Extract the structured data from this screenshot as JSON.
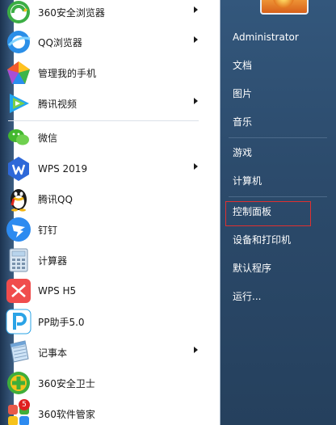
{
  "programs": [
    {
      "label": "360安全浏览器",
      "icon": "360-browser-icon",
      "has_submenu": true
    },
    {
      "label": "QQ浏览器",
      "icon": "qq-browser-icon",
      "has_submenu": true
    },
    {
      "label": "管理我的手机",
      "icon": "phone-manager-icon",
      "has_submenu": false
    },
    {
      "label": "腾讯视频",
      "icon": "tencent-video-icon",
      "has_submenu": true
    },
    {
      "label": "微信",
      "icon": "wechat-icon",
      "has_submenu": false
    },
    {
      "label": "WPS 2019",
      "icon": "wps-icon",
      "has_submenu": true
    },
    {
      "label": "腾讯QQ",
      "icon": "qq-penguin-icon",
      "has_submenu": false
    },
    {
      "label": "钉钉",
      "icon": "dingtalk-icon",
      "has_submenu": false
    },
    {
      "label": "计算器",
      "icon": "calculator-icon",
      "has_submenu": false
    },
    {
      "label": "WPS H5",
      "icon": "wps-h5-icon",
      "has_submenu": false
    },
    {
      "label": "PP助手5.0",
      "icon": "pp-assistant-icon",
      "has_submenu": false
    },
    {
      "label": "记事本",
      "icon": "notepad-icon",
      "has_submenu": true
    },
    {
      "label": "360安全卫士",
      "icon": "360-safe-icon",
      "has_submenu": false
    },
    {
      "label": "360软件管家",
      "icon": "360-software-manager-icon",
      "has_submenu": false,
      "badge": "5"
    }
  ],
  "user_panel": {
    "username": "Administrator",
    "items": [
      {
        "label": "文档"
      },
      {
        "label": "图片"
      },
      {
        "label": "音乐"
      },
      {
        "label": "游戏"
      },
      {
        "label": "计算机"
      },
      {
        "label": "控制面板",
        "highlighted": true
      },
      {
        "label": "设备和打印机"
      },
      {
        "label": "默认程序"
      },
      {
        "label": "运行..."
      }
    ]
  },
  "colors": {
    "highlight_border": "#e03030",
    "right_panel": "#2c4b6c"
  }
}
